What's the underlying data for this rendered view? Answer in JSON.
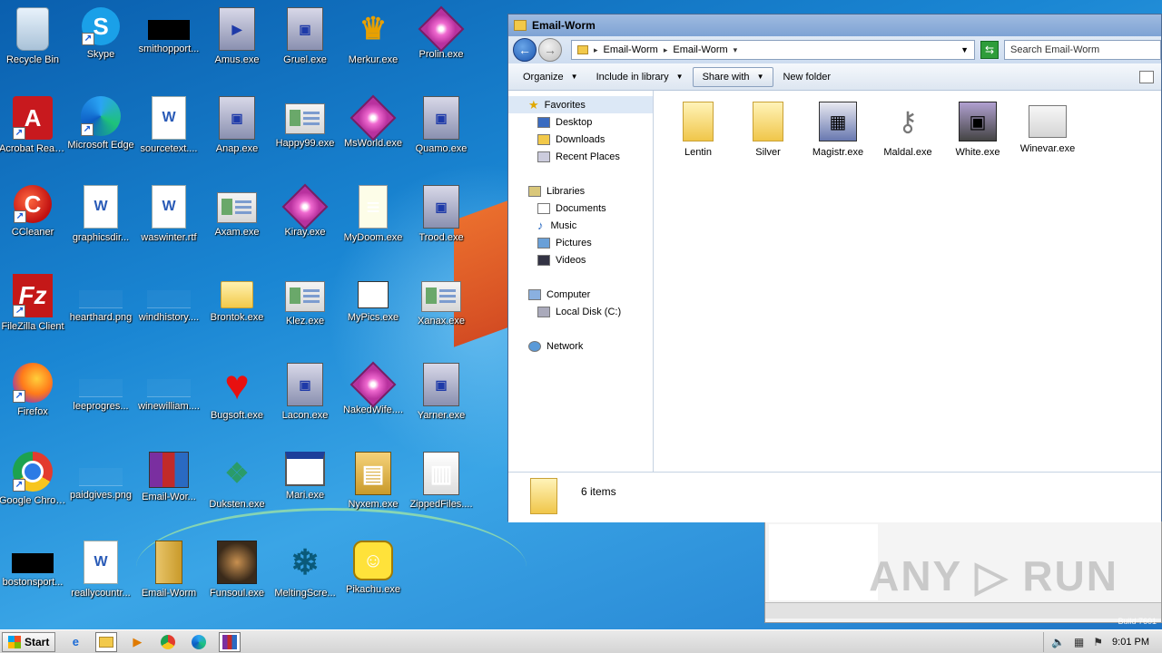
{
  "desktop_icons": [
    {
      "label": "Recycle Bin",
      "icon": "recycle-bin-icon",
      "glyph": ""
    },
    {
      "label": "Skype",
      "icon": "skype-icon",
      "glyph": "S"
    },
    {
      "label": "smithopport...",
      "icon": "black-image-icon",
      "glyph": ""
    },
    {
      "label": "Amus.exe",
      "icon": "media-player-icon",
      "glyph": "▶"
    },
    {
      "label": "Gruel.exe",
      "icon": "setup-computer-icon",
      "glyph": "▣"
    },
    {
      "label": "Merkur.exe",
      "icon": "crown-icon",
      "glyph": "♛"
    },
    {
      "label": "Prolin.exe",
      "icon": "pink-diamond-icon",
      "glyph": ""
    },
    {
      "label": "Acrobat Reader DC",
      "icon": "acrobat-icon",
      "glyph": "A"
    },
    {
      "label": "Microsoft Edge",
      "icon": "edge-icon",
      "glyph": ""
    },
    {
      "label": "sourcetext....",
      "icon": "word-document-icon",
      "glyph": "W"
    },
    {
      "label": "Anap.exe",
      "icon": "setup-computer-icon",
      "glyph": "▣"
    },
    {
      "label": "Happy99.exe",
      "icon": "window-exe-icon",
      "glyph": ""
    },
    {
      "label": "MsWorld.exe",
      "icon": "pink-diamond-icon",
      "glyph": ""
    },
    {
      "label": "Quamo.exe",
      "icon": "setup-computer-icon",
      "glyph": "▣"
    },
    {
      "label": "CCleaner",
      "icon": "ccleaner-icon",
      "glyph": "C"
    },
    {
      "label": "graphicsdir...",
      "icon": "word-document-icon",
      "glyph": "W"
    },
    {
      "label": "waswinter.rtf",
      "icon": "word-document-icon",
      "glyph": "W"
    },
    {
      "label": "Axam.exe",
      "icon": "window-exe-icon",
      "glyph": ""
    },
    {
      "label": "Kiray.exe",
      "icon": "pink-diamond-icon",
      "glyph": ""
    },
    {
      "label": "MyDoom.exe",
      "icon": "notepad-icon",
      "glyph": "≡"
    },
    {
      "label": "Trood.exe",
      "icon": "setup-computer-icon",
      "glyph": "▣"
    },
    {
      "label": "FileZilla Client",
      "icon": "filezilla-icon",
      "glyph": "Fz"
    },
    {
      "label": "hearthard.png",
      "icon": "blank-image-icon",
      "glyph": ""
    },
    {
      "label": "windhistory....",
      "icon": "blank-image-icon",
      "glyph": ""
    },
    {
      "label": "Brontok.exe",
      "icon": "folder-icon",
      "glyph": ""
    },
    {
      "label": "Klez.exe",
      "icon": "window-exe-icon",
      "glyph": ""
    },
    {
      "label": "MyPics.exe",
      "icon": "mypics-icon",
      "glyph": ""
    },
    {
      "label": "Xanax.exe",
      "icon": "window-exe-icon",
      "glyph": ""
    },
    {
      "label": "Firefox",
      "icon": "firefox-icon",
      "glyph": ""
    },
    {
      "label": "leeprogres...",
      "icon": "blank-image-icon",
      "glyph": ""
    },
    {
      "label": "winewilliam....",
      "icon": "blank-image-icon",
      "glyph": ""
    },
    {
      "label": "Bugsoft.exe",
      "icon": "heart-icon",
      "glyph": "♥"
    },
    {
      "label": "Lacon.exe",
      "icon": "setup-computer-icon",
      "glyph": "▣"
    },
    {
      "label": "NakedWife....",
      "icon": "pink-diamond-icon",
      "glyph": ""
    },
    {
      "label": "Yarner.exe",
      "icon": "setup-computer-icon",
      "glyph": "▣"
    },
    {
      "label": "Google Chrome",
      "icon": "chrome-icon",
      "glyph": ""
    },
    {
      "label": "paidgives.png",
      "icon": "blank-image-icon",
      "glyph": ""
    },
    {
      "label": "Email-Wor...",
      "icon": "winrar-icon",
      "glyph": ""
    },
    {
      "label": "Duksten.exe",
      "icon": "cubes-icon",
      "glyph": "❖"
    },
    {
      "label": "Mari.exe",
      "icon": "blank-window-icon",
      "glyph": ""
    },
    {
      "label": "Nyxem.exe",
      "icon": "file-cabinet-icon",
      "glyph": "▤"
    },
    {
      "label": "ZippedFiles....",
      "icon": "zip-cabinet-icon",
      "glyph": "▥"
    },
    {
      "label": "bostonsport...",
      "icon": "black-image-icon",
      "glyph": ""
    },
    {
      "label": "reallycountr...",
      "icon": "word-document-icon",
      "glyph": "W"
    },
    {
      "label": "Email-Worm",
      "icon": "folder-binder-icon",
      "glyph": ""
    },
    {
      "label": "Funsoul.exe",
      "icon": "photo-icon",
      "glyph": ""
    },
    {
      "label": "MeltingScre...",
      "icon": "snowflake-icon",
      "glyph": "❄"
    },
    {
      "label": "Pikachu.exe",
      "icon": "pikachu-icon",
      "glyph": "☺"
    }
  ],
  "explorer": {
    "title": "Email-Worm",
    "breadcrumb": [
      "Email-Worm",
      "Email-Worm"
    ],
    "search_placeholder": "Search Email-Worm",
    "toolbar": {
      "organize": "Organize",
      "include_in_library": "Include in library",
      "share_with": "Share with",
      "new_folder": "New folder"
    },
    "nav": {
      "favorites": "Favorites",
      "desktop": "Desktop",
      "downloads": "Downloads",
      "recent_places": "Recent Places",
      "libraries": "Libraries",
      "documents": "Documents",
      "music": "Music",
      "pictures": "Pictures",
      "videos": "Videos",
      "computer": "Computer",
      "local_disk": "Local Disk (C:)",
      "network": "Network"
    },
    "files": [
      {
        "name": "Lentin",
        "icon": "folder-icon"
      },
      {
        "name": "Silver",
        "icon": "folder-icon"
      },
      {
        "name": "Magistr.exe",
        "icon": "setup-exe-icon"
      },
      {
        "name": "Maldal.exe",
        "icon": "keys-icon"
      },
      {
        "name": "White.exe",
        "icon": "disk-exe-icon"
      },
      {
        "name": "Winevar.exe",
        "icon": "window-exe-icon"
      }
    ],
    "status": "6 items"
  },
  "taskbar": {
    "start": "Start",
    "clock": "9:01 PM"
  },
  "watermark": "ANY ▷ RUN",
  "build_text": "Build 7601"
}
